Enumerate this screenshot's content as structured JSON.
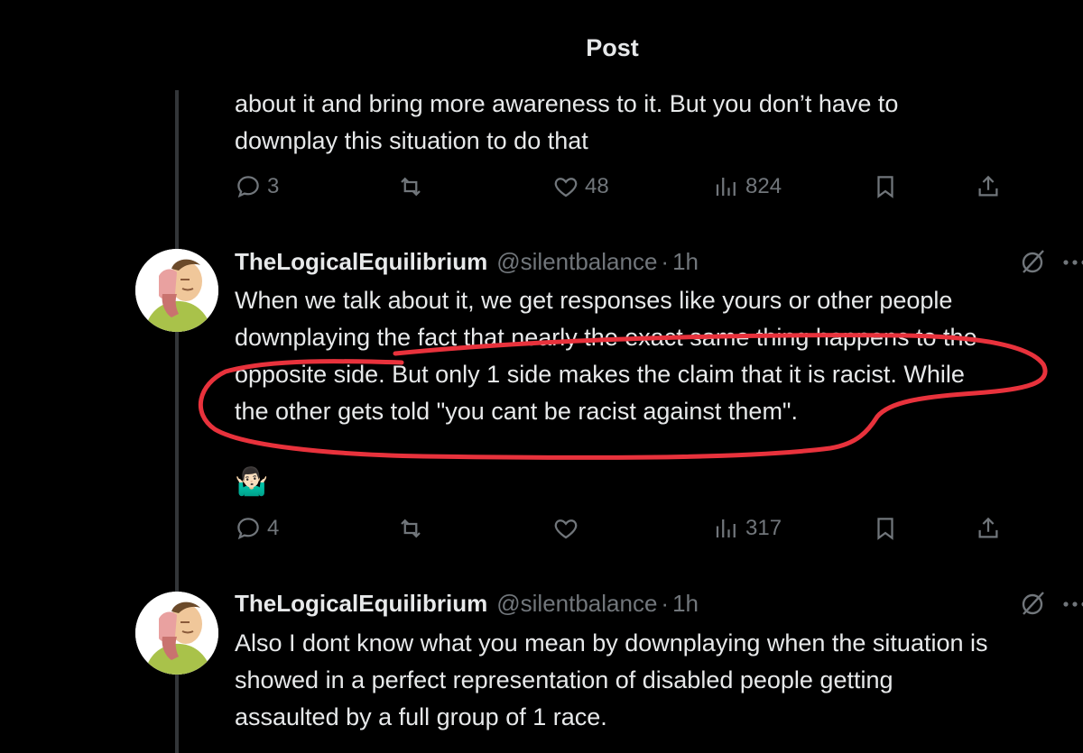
{
  "header": {
    "title": "Post"
  },
  "posts": [
    {
      "text_lines": [
        "about it and bring more awareness to it. But you don’t have to",
        "downplay this situation to do that"
      ],
      "actions": {
        "replies": "3",
        "reposts": "",
        "likes": "48",
        "views": "824"
      }
    },
    {
      "display_name": "TheLogicalEquilibrium",
      "handle": "@silentbalance",
      "separator": "·",
      "time": "1h",
      "text_lines": [
        "When we talk about it, we get responses like yours or other people",
        "downplaying the fact that nearly the exact same thing happens to the",
        "opposite side. But only 1 side makes the claim that it is racist. While",
        "the other gets told \"you cant be racist against them\"."
      ],
      "emoji": "🤷🏻‍♂️",
      "actions": {
        "replies": "4",
        "reposts": "",
        "likes": "",
        "views": "317"
      }
    },
    {
      "display_name": "TheLogicalEquilibrium",
      "handle": "@silentbalance",
      "separator": "·",
      "time": "1h",
      "text_lines": [
        "Also I dont know what you mean by downplaying when the situation is",
        "showed in a perfect representation of disabled people getting",
        "assaulted by a full group of 1 race."
      ]
    }
  ],
  "annotation": {
    "color": "#e8323c"
  },
  "colors": {
    "background": "#000000",
    "text": "#e7e9ea",
    "muted": "#71767b",
    "thread_line": "#333639"
  }
}
